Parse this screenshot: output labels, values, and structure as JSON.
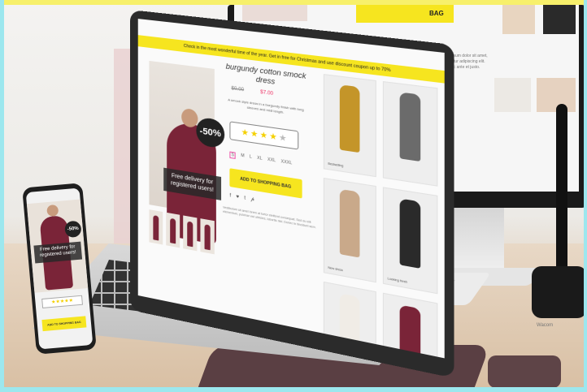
{
  "scene": {
    "description_colors": {
      "accent": "#f6e51f",
      "dress": "#7a2438",
      "frame": "#9ce7ee"
    }
  },
  "monitor": {
    "band_text": "BAG"
  },
  "laptop": {
    "promo": "Check in the most wonderful time of the year. Get in free for Christmas and use discount coupon up to 70%",
    "product_title": "burgundy cotton smock dress",
    "price_old": "$0.00",
    "price_new": "$7.00",
    "discount_badge": "-50%",
    "delivery_banner": "Free delivery for registered users!",
    "short_desc": "A smock style dress in a burgundy finish with long sleeves and midi length.",
    "rating_stars": [
      "★",
      "★",
      "★",
      "★",
      "★"
    ],
    "rating_filled": 4,
    "sizes": [
      "S",
      "M",
      "L",
      "XL",
      "XXL",
      "XXXL"
    ],
    "add_to_cart": "ADD TO SHOPPING BAG",
    "social": [
      "f",
      "♥",
      "t",
      "𝓅"
    ],
    "long_desc": "Vestibulum sit amet lorem at tortor eleifend consequat. Sed eu elit elementum, pulvinar est ultricies, lobortis nisi. Donec in tincidunt sem.",
    "grid": [
      {
        "label": "Bestselling",
        "color": "#c49529"
      },
      {
        "label": "",
        "color": "#6b6b6b"
      },
      {
        "label": "New dress",
        "color": "#c9a98a"
      },
      {
        "label": "Looking fresh",
        "color": "#2a2a2a"
      },
      {
        "label": "",
        "color": "#f0ece6"
      },
      {
        "label": "",
        "color": "#7a2438"
      }
    ]
  },
  "phone": {
    "discount_badge": "-50%",
    "delivery_banner": "Free delivery for registered users!",
    "stars": "★★★★★",
    "add_to_cart": "ADD TO SHOPPING BAG"
  },
  "cup": {
    "brand": "Wacom"
  }
}
